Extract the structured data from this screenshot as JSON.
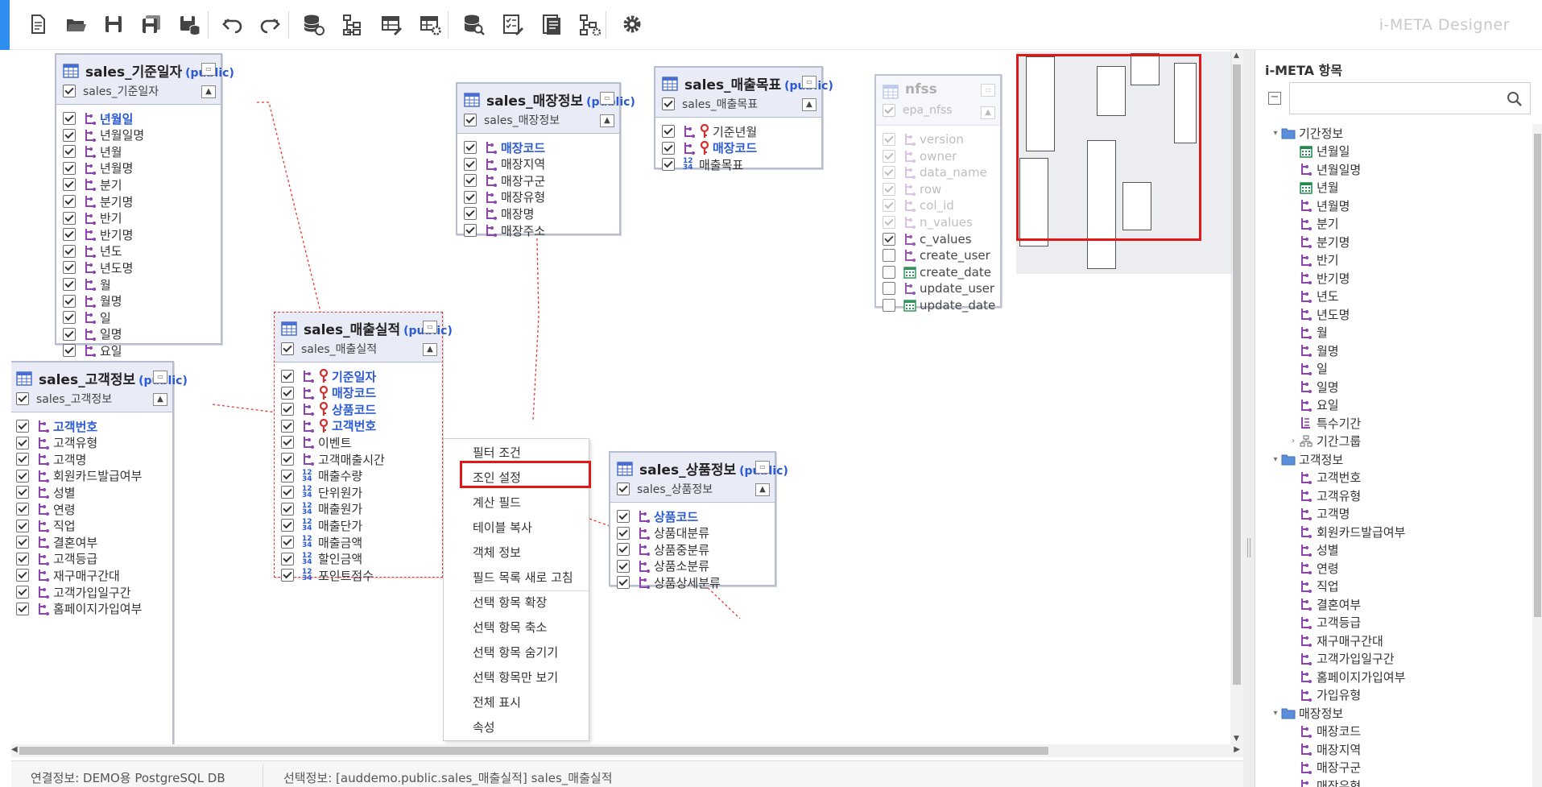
{
  "app": {
    "brand": "i-META Designer"
  },
  "toolbar": {
    "buttons": [
      {
        "name": "new-document-button",
        "icon": "new-document-icon"
      },
      {
        "name": "open-folder-button",
        "icon": "folder-open-icon"
      },
      {
        "name": "save-button",
        "icon": "save-icon"
      },
      {
        "name": "save-all-button",
        "icon": "save-all-icon"
      },
      {
        "name": "save-db-button",
        "icon": "save-db-icon"
      },
      {
        "name": "undo-button",
        "icon": "undo-icon"
      },
      {
        "name": "redo-button",
        "icon": "redo-icon"
      },
      {
        "name": "db-connect-button",
        "icon": "database-link-icon"
      },
      {
        "name": "hierarchy-button",
        "icon": "hierarchy-icon"
      },
      {
        "name": "table-edit-button",
        "icon": "table-edit-icon"
      },
      {
        "name": "table-settings-button",
        "icon": "table-settings-icon"
      },
      {
        "name": "db-search-button",
        "icon": "database-search-icon"
      },
      {
        "name": "checklist-button",
        "icon": "checklist-icon"
      },
      {
        "name": "document-button",
        "icon": "document-icon"
      },
      {
        "name": "tree-settings-button",
        "icon": "tree-settings-icon"
      },
      {
        "name": "settings-button",
        "icon": "gear-icon"
      }
    ]
  },
  "entities": {
    "date": {
      "title": "sales_기준일자",
      "schema": "(public)",
      "alias": "sales_기준일자",
      "fields": [
        {
          "label": "년월일",
          "key": true
        },
        {
          "label": "년월일명"
        },
        {
          "label": "년월"
        },
        {
          "label": "년월명"
        },
        {
          "label": "분기"
        },
        {
          "label": "분기명"
        },
        {
          "label": "반기"
        },
        {
          "label": "반기명"
        },
        {
          "label": "년도"
        },
        {
          "label": "년도명"
        },
        {
          "label": "월"
        },
        {
          "label": "월명"
        },
        {
          "label": "일"
        },
        {
          "label": "일명"
        },
        {
          "label": "요일"
        }
      ]
    },
    "store": {
      "title": "sales_매장정보",
      "schema": "(public)",
      "alias": "sales_매장정보",
      "fields": [
        {
          "label": "매장코드",
          "key": true
        },
        {
          "label": "매장지역"
        },
        {
          "label": "매장구군"
        },
        {
          "label": "매장유형"
        },
        {
          "label": "매장명"
        },
        {
          "label": "매장주소"
        }
      ]
    },
    "target": {
      "title": "sales_매출목표",
      "schema": "(public)",
      "alias": "sales_매출목표",
      "fields": [
        {
          "label": "기준년월",
          "pk": true
        },
        {
          "label": "매장코드",
          "pk": true,
          "key": true
        },
        {
          "label": "매출목표",
          "num": true
        }
      ]
    },
    "sales": {
      "title": "sales_매출실적",
      "schema": "(public)",
      "alias": "sales_매출실적",
      "fields": [
        {
          "label": "기준일자",
          "pk": true,
          "key": true
        },
        {
          "label": "매장코드",
          "pk": true,
          "key": true
        },
        {
          "label": "상품코드",
          "pk": true,
          "key": true
        },
        {
          "label": "고객번호",
          "pk": true,
          "key": true
        },
        {
          "label": "이벤트"
        },
        {
          "label": "고객매출시간"
        },
        {
          "label": "매출수량",
          "num": true
        },
        {
          "label": "단위원가",
          "num": true
        },
        {
          "label": "매출원가",
          "num": true
        },
        {
          "label": "매출단가",
          "num": true
        },
        {
          "label": "매출금액",
          "num": true
        },
        {
          "label": "할인금액",
          "num": true
        },
        {
          "label": "포인트점수",
          "num": true
        }
      ]
    },
    "customer": {
      "title": "sales_고객정보",
      "schema": "(public)",
      "alias": "sales_고객정보",
      "fields": [
        {
          "label": "고객번호",
          "key": true
        },
        {
          "label": "고객유형"
        },
        {
          "label": "고객명"
        },
        {
          "label": "회원카드발급여부"
        },
        {
          "label": "성별"
        },
        {
          "label": "연령"
        },
        {
          "label": "직업"
        },
        {
          "label": "결혼여부"
        },
        {
          "label": "고객등급"
        },
        {
          "label": "재구매구간대"
        },
        {
          "label": "고객가입일구간"
        },
        {
          "label": "홈페이지가입여부"
        }
      ]
    },
    "product": {
      "title": "sales_상품정보",
      "schema": "(public)",
      "alias": "sales_상품정보",
      "fields": [
        {
          "label": "상품코드",
          "key": true
        },
        {
          "label": "상품대분류"
        },
        {
          "label": "상품중분류"
        },
        {
          "label": "상품소분류"
        },
        {
          "label": "상품상세분류"
        }
      ]
    },
    "nfss": {
      "title": "nfss",
      "alias": "epa_nfss",
      "fields": [
        {
          "label": "version"
        },
        {
          "label": "owner"
        },
        {
          "label": "data_name"
        },
        {
          "label": "row"
        },
        {
          "label": "col_id"
        },
        {
          "label": "n_values"
        },
        {
          "label": "c_values",
          "checked": true
        },
        {
          "label": "create_user",
          "checked": false
        },
        {
          "label": "create_date",
          "checked": false,
          "date": true
        },
        {
          "label": "update_user",
          "checked": false
        },
        {
          "label": "update_date",
          "checked": false,
          "date": true
        }
      ]
    }
  },
  "context_menu": {
    "items": [
      "필터 조건",
      "조인 설정",
      "계산 필드",
      "테이블 복사",
      "객체 정보",
      "필드 목록 새로 고침",
      "선택 항목 확장",
      "선택 항목 축소",
      "선택 항목 숨기기",
      "선택 항목만 보기",
      "전체 표시",
      "속성"
    ],
    "highlighted": "조인 설정"
  },
  "status": {
    "connection": "연결정보: DEMO용 PostgreSQL DB",
    "selection": "선택정보: [auddemo.public.sales_매출실적] sales_매출실적"
  },
  "panel": {
    "title": "i-META 항목",
    "search_placeholder": "",
    "tree": [
      {
        "label": "기간정보",
        "type": "folder",
        "level": 0,
        "expanded": true
      },
      {
        "label": "년월일",
        "type": "date",
        "level": 1
      },
      {
        "label": "년월일명",
        "type": "dim",
        "level": 1
      },
      {
        "label": "년월",
        "type": "date",
        "level": 1
      },
      {
        "label": "년월명",
        "type": "dim",
        "level": 1
      },
      {
        "label": "분기",
        "type": "dim",
        "level": 1
      },
      {
        "label": "분기명",
        "type": "dim",
        "level": 1
      },
      {
        "label": "반기",
        "type": "dim",
        "level": 1
      },
      {
        "label": "반기명",
        "type": "dim",
        "level": 1
      },
      {
        "label": "년도",
        "type": "dim",
        "level": 1
      },
      {
        "label": "년도명",
        "type": "dim",
        "level": 1
      },
      {
        "label": "월",
        "type": "dim",
        "level": 1
      },
      {
        "label": "월명",
        "type": "dim",
        "level": 1
      },
      {
        "label": "일",
        "type": "dim",
        "level": 1
      },
      {
        "label": "일명",
        "type": "dim",
        "level": 1
      },
      {
        "label": "요일",
        "type": "dim",
        "level": 1
      },
      {
        "label": "특수기간",
        "type": "special",
        "level": 1
      },
      {
        "label": "기간그룹",
        "type": "group",
        "level": 1,
        "collapsed": true
      },
      {
        "label": "고객정보",
        "type": "folder",
        "level": 0,
        "expanded": true
      },
      {
        "label": "고객번호",
        "type": "dim",
        "level": 1
      },
      {
        "label": "고객유형",
        "type": "dim",
        "level": 1
      },
      {
        "label": "고객명",
        "type": "dim",
        "level": 1
      },
      {
        "label": "회원카드발급여부",
        "type": "dim",
        "level": 1
      },
      {
        "label": "성별",
        "type": "dim",
        "level": 1
      },
      {
        "label": "연령",
        "type": "dim",
        "level": 1
      },
      {
        "label": "직업",
        "type": "dim",
        "level": 1
      },
      {
        "label": "결혼여부",
        "type": "dim",
        "level": 1
      },
      {
        "label": "고객등급",
        "type": "dim",
        "level": 1
      },
      {
        "label": "재구매구간대",
        "type": "dim",
        "level": 1
      },
      {
        "label": "고객가입일구간",
        "type": "dim",
        "level": 1
      },
      {
        "label": "홈페이지가입여부",
        "type": "dim",
        "level": 1
      },
      {
        "label": "가입유형",
        "type": "dim",
        "level": 1
      },
      {
        "label": "매장정보",
        "type": "folder",
        "level": 0,
        "expanded": true
      },
      {
        "label": "매장코드",
        "type": "dim",
        "level": 1
      },
      {
        "label": "매장지역",
        "type": "dim",
        "level": 1
      },
      {
        "label": "매장구군",
        "type": "dim",
        "level": 1
      },
      {
        "label": "매장유형",
        "type": "dim",
        "level": 1
      }
    ]
  },
  "colors": {
    "accent": "#2f8ef0",
    "highlight": "#e01818",
    "key_text": "#2b5ad6",
    "dim_icon": "#8e44ad",
    "pk_icon": "#d32f2f",
    "date_icon": "#1e8a4c",
    "header_bg": "#e9ecf7"
  }
}
